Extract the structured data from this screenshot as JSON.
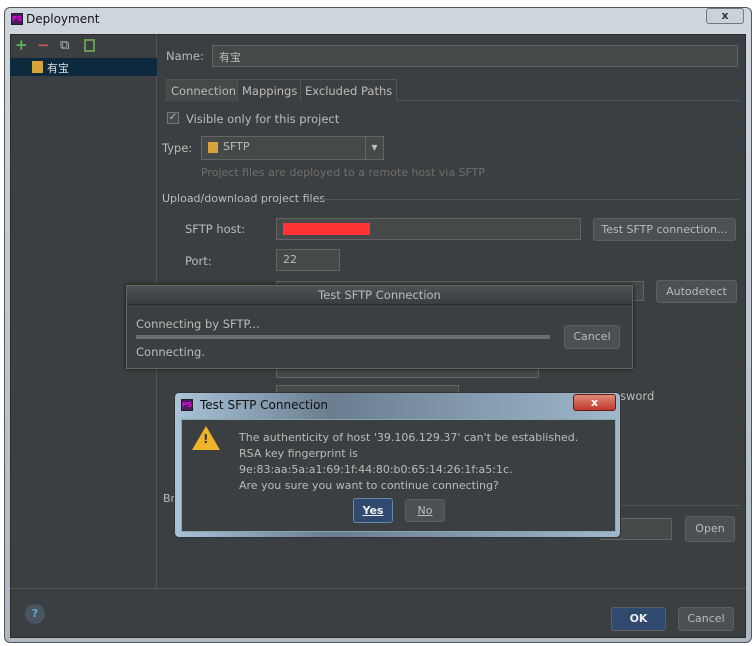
{
  "window": {
    "title": "Deployment",
    "close": "x"
  },
  "sidebar": {
    "toolbar": {
      "add": "+",
      "remove": "−",
      "copy": "⧉"
    },
    "items": [
      {
        "label": "有宝"
      }
    ]
  },
  "form": {
    "name_label": "Name:",
    "name_value": "有宝",
    "tabs": [
      {
        "label": "Connection",
        "active": true
      },
      {
        "label": "Mappings"
      },
      {
        "label": "Excluded Paths"
      }
    ],
    "visible_only": {
      "label": "Visible only for this project",
      "checked": true
    },
    "type_label": "Type:",
    "type_value": "SFTP",
    "type_hint": "Project files are deployed to a remote host via SFTP",
    "section": "Upload/download project files",
    "host_label": "SFTP host:",
    "test_button": "Test SFTP connection...",
    "port_label": "Port:",
    "port_value": "22",
    "autodetect": "Autodetect",
    "partial_save_password": "sword",
    "partial_browse": "Br",
    "open_button": "Open"
  },
  "progress_dialog": {
    "title": "Test SFTP Connection",
    "status": "Connecting by SFTP...",
    "detail": "Connecting.",
    "cancel": "Cancel"
  },
  "confirm_dialog": {
    "title": "Test SFTP Connection",
    "close": "x",
    "lines": [
      "The authenticity of host '39.106.129.37' can't be established.",
      "RSA key fingerprint is 9e:83:aa:5a:a1:69:1f:44:80:b0:65:14:26:1f:a5:1c.",
      "Are you sure you want to continue connecting?"
    ],
    "yes": "Yes",
    "no": "No"
  },
  "footer": {
    "help": "?",
    "ok": "OK",
    "cancel": "Cancel"
  },
  "colors": {
    "redacted": "#ff3333",
    "accent": "#2f4a6e"
  }
}
